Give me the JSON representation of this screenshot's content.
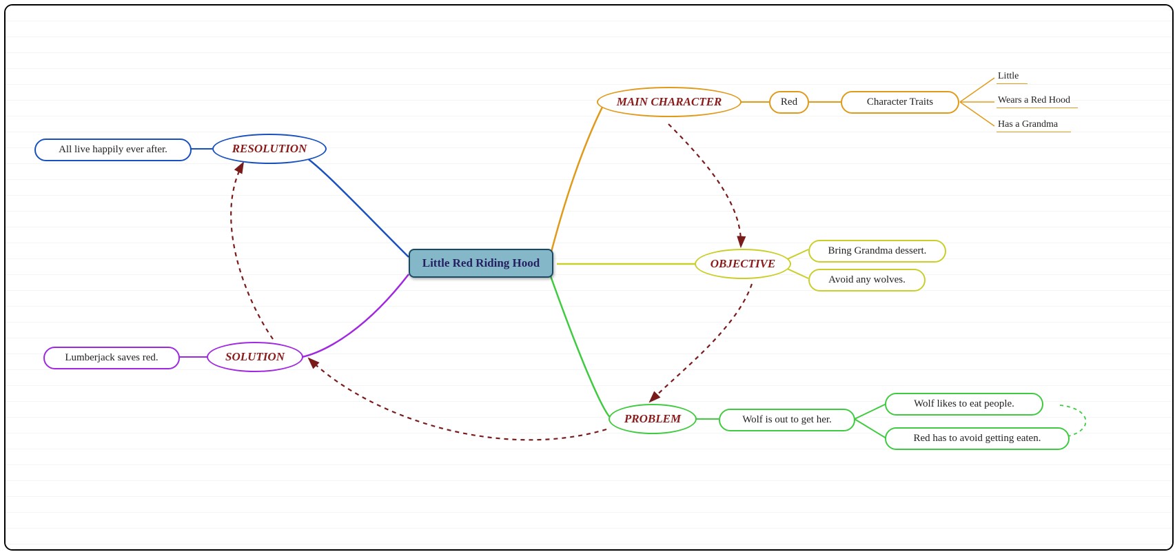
{
  "center": "Little Red Riding Hood",
  "colors": {
    "orange": "#e09a1a",
    "yellow": "#c9cf28",
    "green": "#3fcb3f",
    "purple": "#a028e0",
    "blue": "#1950c0",
    "textred": "#8b1a1a",
    "dashed": "#7a1b1b"
  },
  "sections": {
    "mainChar": {
      "label": "MAIN CHARACTER",
      "color": "orange"
    },
    "objective": {
      "label": "OBJECTIVE",
      "color": "yellow"
    },
    "problem": {
      "label": "PROBLEM",
      "color": "green"
    },
    "solution": {
      "label": "SOLUTION",
      "color": "purple"
    },
    "resolution": {
      "label": "RESOLUTION",
      "color": "blue"
    }
  },
  "mainChar": {
    "name": "Red",
    "traitsLabel": "Character Traits",
    "traits": [
      "Little",
      "Wears a Red Hood",
      "Has a Grandma"
    ]
  },
  "objective": [
    "Bring Grandma dessert.",
    "Avoid any wolves."
  ],
  "problem": {
    "summary": "Wolf is out to get her.",
    "details": [
      "Wolf likes to eat people.",
      "Red has to avoid getting eaten."
    ]
  },
  "solution": "Lumberjack saves red.",
  "resolution": "All live happily ever after."
}
